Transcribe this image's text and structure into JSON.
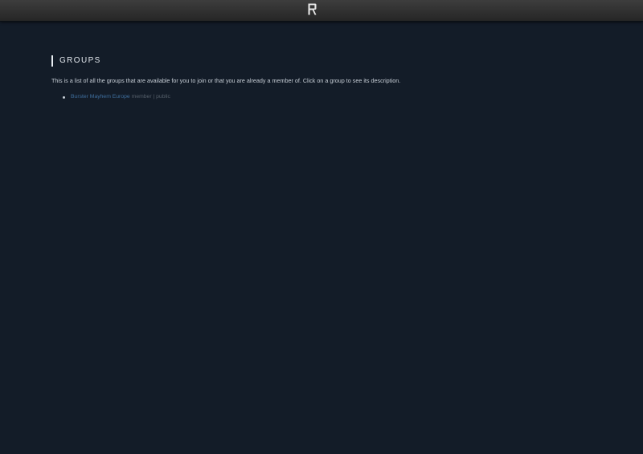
{
  "header": {
    "logo_icon": "r-logo-icon"
  },
  "groups_page": {
    "heading": "GROUPS",
    "intro": "This is a list of all the groups that are available for you to join or that you are already a member of. Click on a group to see its description.",
    "groups": [
      {
        "name": "Burster Mayhem Europe",
        "meta": "member | public"
      }
    ]
  },
  "colors": {
    "background": "#131c28",
    "topbar": "#2e2e2e",
    "link": "#3f6f9e",
    "muted": "#56606b"
  }
}
